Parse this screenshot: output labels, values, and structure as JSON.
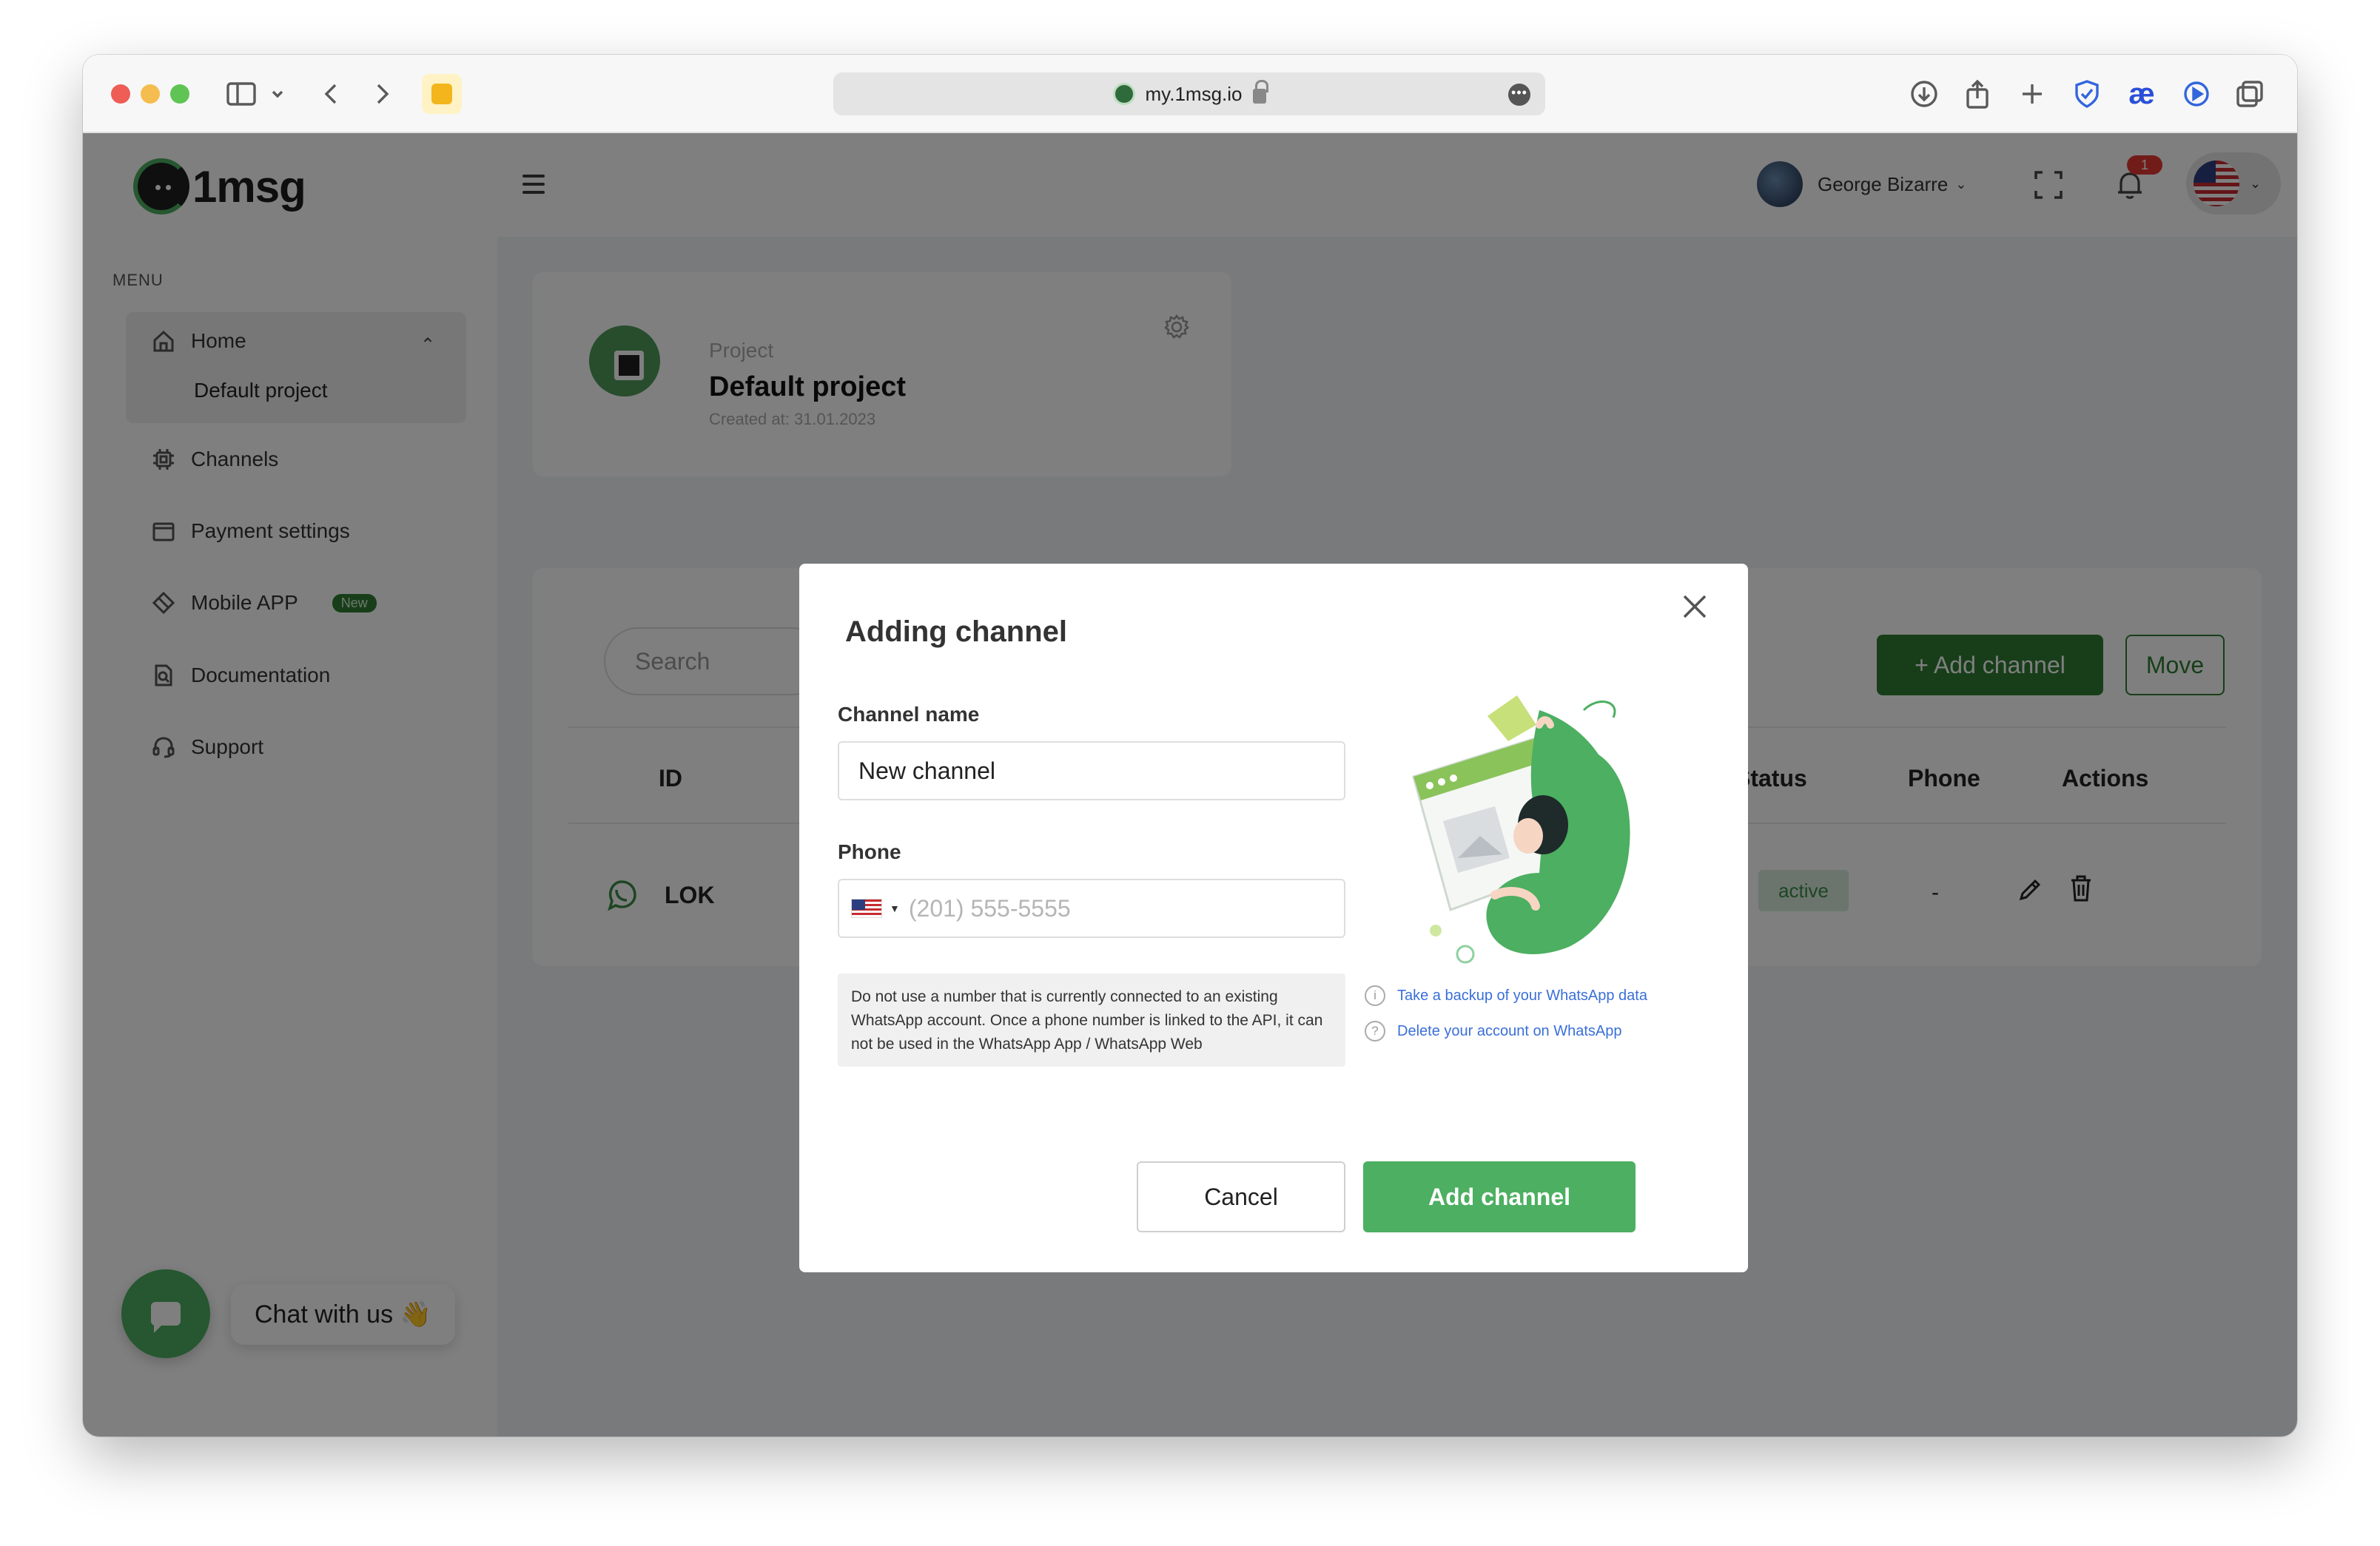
{
  "browser": {
    "url": "my.1msg.io"
  },
  "header": {
    "logo_text": "1msg",
    "user_name": "George Bizarre",
    "notification_count": "1"
  },
  "sidebar": {
    "menu_title": "MENU",
    "home_label": "Home",
    "home_sub": "Default project",
    "items": [
      {
        "label": "Channels",
        "icon": "chip-icon"
      },
      {
        "label": "Payment settings",
        "icon": "wallet-icon"
      },
      {
        "label": "Mobile APP",
        "icon": "diamond-icon",
        "badge": "New"
      },
      {
        "label": "Documentation",
        "icon": "document-search-icon"
      },
      {
        "label": "Support",
        "icon": "headset-icon"
      }
    ]
  },
  "project": {
    "label": "Project",
    "name": "Default project",
    "created": "Created at: 31.01.2023"
  },
  "channels": {
    "search_placeholder": "Search",
    "add_button": "+ Add channel",
    "move_button": "Move",
    "columns": [
      "ID",
      "Status",
      "Phone",
      "Actions"
    ],
    "rows": [
      {
        "name": "LOK",
        "status": "active",
        "phone": "-"
      }
    ]
  },
  "chat": {
    "label": "Chat with us 👋"
  },
  "modal": {
    "title": "Adding channel",
    "channel_name_label": "Channel name",
    "channel_name_value": "New channel",
    "phone_label": "Phone",
    "phone_placeholder": "(201) 555-5555",
    "warning": "Do not use a number that is currently connected to an existing WhatsApp account. Once a phone number is linked to the API, it can not be used in the WhatsApp App / WhatsApp Web",
    "links": [
      {
        "label": "Take a backup of your WhatsApp data",
        "icon": "info-icon"
      },
      {
        "label": "Delete your account on WhatsApp",
        "icon": "question-icon"
      }
    ],
    "cancel": "Cancel",
    "submit": "Add channel"
  },
  "colors": {
    "accent": "#4caf61",
    "accent_dark": "#2e7d32",
    "link": "#3a6fd8"
  }
}
